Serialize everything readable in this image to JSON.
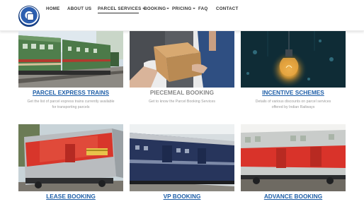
{
  "nav": {
    "items": [
      {
        "label": "HOME",
        "dropdown": false
      },
      {
        "label": "ABOUT US",
        "dropdown": false
      },
      {
        "label": "PARCEL SERVICES",
        "dropdown": true
      },
      {
        "label": "BOOKING",
        "dropdown": true
      },
      {
        "label": "PRICING",
        "dropdown": true
      },
      {
        "label": "FAQ",
        "dropdown": false
      },
      {
        "label": "CONTACT",
        "dropdown": false
      }
    ]
  },
  "cards": [
    {
      "title": "PARCEL EXPRESS TRAINS",
      "desc_line1": "Get the list of parcel express trains currently available",
      "desc_line2": "for transporting parcels",
      "image": "train-photo"
    },
    {
      "title": "PIECEMEAL BOOKING",
      "desc_line1": "Get to know the Parcel Booking Services",
      "desc_line2": "",
      "image": "parcel-handover-photo"
    },
    {
      "title": "INCENTIVE SCHEMES",
      "desc_line1": "Details of various discounts on parcel services",
      "desc_line2": "offered by Indian Railways",
      "image": "light-bulb-photo"
    },
    {
      "title": "LEASE BOOKING",
      "image": "red-coach-photo"
    },
    {
      "title": "VP BOOKING",
      "image": "blue-van-photo"
    },
    {
      "title": "ADVANCE BOOKING",
      "image": "red-van-photo"
    }
  ],
  "colors": {
    "link": "#1f5fa8",
    "muted_title": "#888888",
    "text": "#999999",
    "nav_text": "#333333"
  }
}
